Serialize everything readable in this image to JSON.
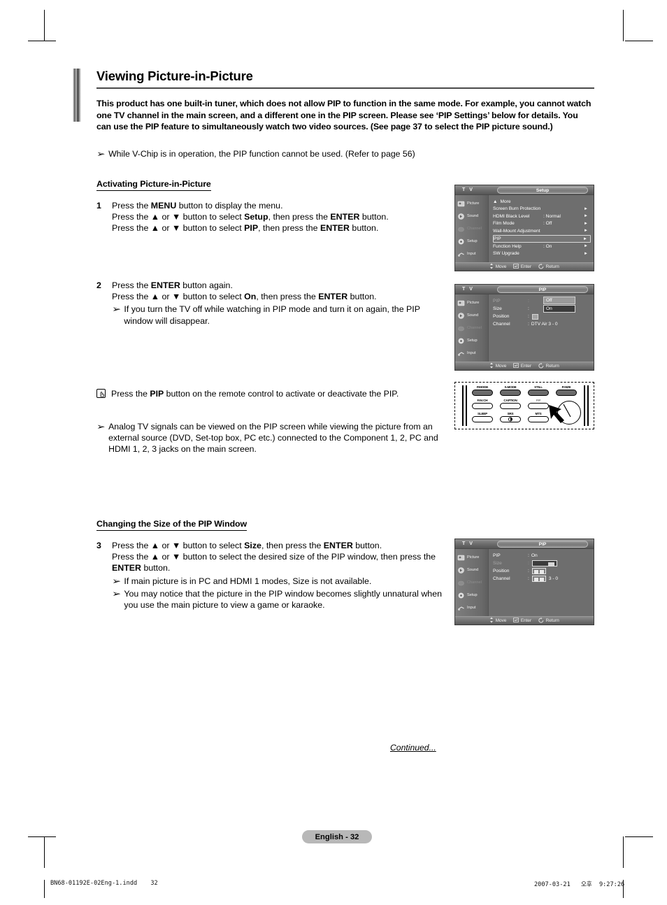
{
  "page": {
    "title": "Viewing Picture-in-Picture",
    "intro": "This product has one built-in tuner, which does not allow PIP to function in the same mode. For example, you cannot watch one TV channel in the main screen, and a different one in the PIP screen. Please see ‘PIP Settings’ below for details. You can use the PIP feature to simultaneously watch two video sources. (See page 37 to select the PIP picture sound.)",
    "top_note": "While V-Chip is in operation, the PIP function cannot be used. (Refer to page 56)",
    "bullet_glyph": "➢",
    "continued": "Continued...",
    "page_badge": "English - 32"
  },
  "sections": [
    {
      "heading": "Activating Picture-in-Picture"
    },
    {
      "heading": "Changing the Size of the PIP Window"
    }
  ],
  "steps": {
    "step1": {
      "number": "1",
      "line1_a": "Press the ",
      "line1_b": "MENU",
      "line1_c": " button to display the menu.",
      "line2_a": "Press the ▲ or ▼ button to select ",
      "line2_b": "Setup",
      "line2_c": ", then press the ",
      "line2_d": "ENTER",
      "line2_e": " button.",
      "line3_a": "Press the ▲ or ▼ button to select ",
      "line3_b": "PIP",
      "line3_c": ", then press the ",
      "line3_d": "ENTER",
      "line3_e": " button."
    },
    "step2": {
      "number": "2",
      "line1_a": "Press the ",
      "line1_b": "ENTER",
      "line1_c": " button again.",
      "line2_a": "Press the ▲ or ▼ button to select ",
      "line2_b": "On",
      "line2_c": ", then press the ",
      "line2_d": "ENTER",
      "line2_e": " button.",
      "note": "If you turn the TV off while watching in PIP mode and turn it on again, the PIP window will disappear."
    },
    "step3": {
      "number": "3",
      "line1_a": "Press the ▲ or ▼ button to select ",
      "line1_b": "Size",
      "line1_c": ", then press the ",
      "line1_d": "ENTER",
      "line1_e": " button.",
      "line2_a": "Press the ▲ or ▼ button to select the desired size of the PIP window, then press the ",
      "line2_b": "ENTER",
      "line2_c": " button.",
      "note1": "If main picture is in PC and HDMI 1 modes, Size is not available.",
      "note2": "You may notice that the picture in the PIP window becomes slightly unnatural when you use the main picture to view a game or karaoke."
    }
  },
  "hand_note": {
    "icon": "hand-pointer-icon",
    "text_a": "Press the ",
    "text_b": "PIP",
    "text_c": " button on the remote control to activate or deactivate the PIP."
  },
  "analog_note": "Analog TV signals can be viewed on the PIP screen while viewing the picture from an external source (DVD, Set-top box, PC etc.) connected to the Component 1, 2, PC and HDMI 1, 2, 3 jacks on the main screen.",
  "osd_common": {
    "tv_label": "T V",
    "sidebar": [
      {
        "label": "Picture",
        "icon": "picture-icon",
        "dim": false
      },
      {
        "label": "Sound",
        "icon": "sound-icon",
        "dim": false
      },
      {
        "label": "Channel",
        "icon": "channel-icon",
        "dim": true
      },
      {
        "label": "Setup",
        "icon": "setup-icon",
        "dim": false
      },
      {
        "label": "Input",
        "icon": "input-icon",
        "dim": false
      }
    ],
    "bottom": [
      {
        "label": "Move",
        "icon": "updown-arrows-icon"
      },
      {
        "label": "Enter",
        "icon": "enter-key-icon"
      },
      {
        "label": "Return",
        "icon": "return-arrow-icon"
      }
    ]
  },
  "osd_setup": {
    "title": "Setup",
    "rows": [
      {
        "label": "More",
        "value": "",
        "chevron": "",
        "dim": false,
        "selected": false,
        "up_arrow": true
      },
      {
        "label": "Screen Burn Protection",
        "value": "",
        "chevron": "►",
        "dim": false,
        "selected": false
      },
      {
        "label": "HDMI Black Level",
        "value": ": Normal",
        "chevron": "►",
        "dim": false,
        "selected": false
      },
      {
        "label": "Film Mode",
        "value": ": Off",
        "chevron": "►",
        "dim": false,
        "selected": false
      },
      {
        "label": "Wall-Mount Adjustment",
        "value": "",
        "chevron": "►",
        "dim": false,
        "selected": false
      },
      {
        "label": "PIP",
        "value": "",
        "chevron": "►",
        "dim": false,
        "selected": true
      },
      {
        "label": "Function Help",
        "value": ": On",
        "chevron": "►",
        "dim": false,
        "selected": false
      },
      {
        "label": "SW Upgrade",
        "value": "",
        "chevron": "►",
        "dim": false,
        "selected": false
      }
    ]
  },
  "osd_pip_on": {
    "title": "PIP",
    "rows": [
      {
        "label": "PIP",
        "colon": ":",
        "dim": true
      },
      {
        "label": "Size",
        "colon": ":",
        "dim": false
      },
      {
        "label": "Position",
        "colon": ":",
        "dim": false
      },
      {
        "label": "Channel",
        "colon": ":",
        "dim": false,
        "value": "DTV Air 3 - 0"
      }
    ],
    "dropdown": {
      "option_off": "Off",
      "option_on": "On",
      "selected": "On"
    }
  },
  "osd_pip_size": {
    "title": "PIP",
    "rows": [
      {
        "label": "PIP",
        "colon": ":",
        "value": "On",
        "dim": false
      },
      {
        "label": "Size",
        "colon": ":",
        "value": "",
        "dim": true,
        "glyph": "size-large-icon",
        "selected": true
      },
      {
        "label": "Position",
        "colon": ":",
        "value": "",
        "dim": false,
        "glyph": "size-double-icon"
      },
      {
        "label": "Channel",
        "colon": ":",
        "value": "3 - 0",
        "dim": false,
        "glyph": "size-double-icon"
      }
    ]
  },
  "remote": {
    "name": "remote-control-diagram",
    "buttons": [
      {
        "label": "P.MODE",
        "filled": true
      },
      {
        "label": "S.MODE",
        "filled": true
      },
      {
        "label": "STILL",
        "filled": true
      },
      {
        "label": "P.SIZE",
        "filled": true
      },
      {
        "label": "FAV.CH",
        "filled": false
      },
      {
        "label": "CAPTION",
        "filled": false
      },
      {
        "label": "PIP",
        "filled": false
      },
      {
        "label": "SLEEP",
        "filled": false
      },
      {
        "label": "SRS",
        "filled": false
      },
      {
        "label": "MTS",
        "filled": false
      }
    ]
  },
  "footer": {
    "file": "BN68-01192E-02Eng-1.indd",
    "page_num": "32",
    "date": "2007-03-21",
    "ampm": "오후",
    "time": "9:27:26"
  }
}
